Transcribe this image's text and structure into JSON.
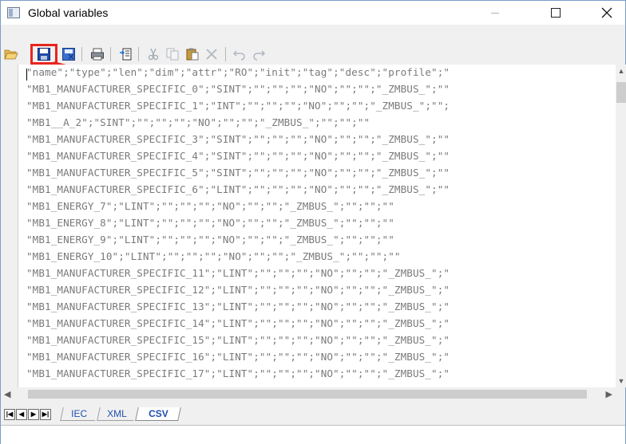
{
  "window": {
    "title": "Global variables"
  },
  "toolbar": {
    "buttons": [
      "open-folder",
      "save",
      "export",
      "print",
      "import",
      "cut",
      "copy",
      "paste",
      "delete",
      "undo",
      "redo"
    ]
  },
  "editor": {
    "lines": [
      "\"name\";\"type\";\"len\";\"dim\";\"attr\";\"RO\";\"init\";\"tag\";\"desc\";\"profile\";\"",
      "\"MB1_MANUFACTURER_SPECIFIC_0\";\"SINT\";\"\";\"\";\"\";\"NO\";\"\";\"\";\"_ZMBUS_\";\"\"",
      "\"MB1_MANUFACTURER_SPECIFIC_1\";\"INT\";\"\";\"\";\"\";\"NO\";\"\";\"\";\"_ZMBUS_\";\"\";",
      "\"MB1__A_2\";\"SINT\";\"\";\"\";\"\";\"NO\";\"\";\"\";\"_ZMBUS_\";\"\";\"\";\"\"",
      "\"MB1_MANUFACTURER_SPECIFIC_3\";\"SINT\";\"\";\"\";\"\";\"NO\";\"\";\"\";\"_ZMBUS_\";\"\"",
      "\"MB1_MANUFACTURER_SPECIFIC_4\";\"SINT\";\"\";\"\";\"\";\"NO\";\"\";\"\";\"_ZMBUS_\";\"\"",
      "\"MB1_MANUFACTURER_SPECIFIC_5\";\"SINT\";\"\";\"\";\"\";\"NO\";\"\";\"\";\"_ZMBUS_\";\"\"",
      "\"MB1_MANUFACTURER_SPECIFIC_6\";\"LINT\";\"\";\"\";\"\";\"NO\";\"\";\"\";\"_ZMBUS_\";\"\"",
      "\"MB1_ENERGY_7\";\"LINT\";\"\";\"\";\"\";\"NO\";\"\";\"\";\"_ZMBUS_\";\"\";\"\";\"\"",
      "\"MB1_ENERGY_8\";\"LINT\";\"\";\"\";\"\";\"NO\";\"\";\"\";\"_ZMBUS_\";\"\";\"\";\"\"",
      "\"MB1_ENERGY_9\";\"LINT\";\"\";\"\";\"\";\"NO\";\"\";\"\";\"_ZMBUS_\";\"\";\"\";\"\"",
      "\"MB1_ENERGY_10\";\"LINT\";\"\";\"\";\"\";\"NO\";\"\";\"\";\"_ZMBUS_\";\"\";\"\";\"\"",
      "\"MB1_MANUFACTURER_SPECIFIC_11\";\"LINT\";\"\";\"\";\"\";\"NO\";\"\";\"\";\"_ZMBUS_\";\"",
      "\"MB1_MANUFACTURER_SPECIFIC_12\";\"LINT\";\"\";\"\";\"\";\"NO\";\"\";\"\";\"_ZMBUS_\";\"",
      "\"MB1_MANUFACTURER_SPECIFIC_13\";\"LINT\";\"\";\"\";\"\";\"NO\";\"\";\"\";\"_ZMBUS_\";\"",
      "\"MB1_MANUFACTURER_SPECIFIC_14\";\"LINT\";\"\";\"\";\"\";\"NO\";\"\";\"\";\"_ZMBUS_\";\"",
      "\"MB1_MANUFACTURER_SPECIFIC_15\";\"LINT\";\"\";\"\";\"\";\"NO\";\"\";\"\";\"_ZMBUS_\";\"",
      "\"MB1_MANUFACTURER_SPECIFIC_16\";\"LINT\";\"\";\"\";\"\";\"NO\";\"\";\"\";\"_ZMBUS_\";\"",
      "\"MB1_MANUFACTURER_SPECIFIC_17\";\"LINT\";\"\";\"\";\"\";\"NO\";\"\";\"\";\"_ZMBUS_\";\""
    ]
  },
  "tabs": [
    {
      "label": "IEC",
      "active": false
    },
    {
      "label": "XML",
      "active": false
    },
    {
      "label": "CSV",
      "active": true
    }
  ],
  "colors": {
    "highlight": "#e8251f",
    "tab_text": "#1f4fb0",
    "editor_text": "#7a7a7a"
  }
}
